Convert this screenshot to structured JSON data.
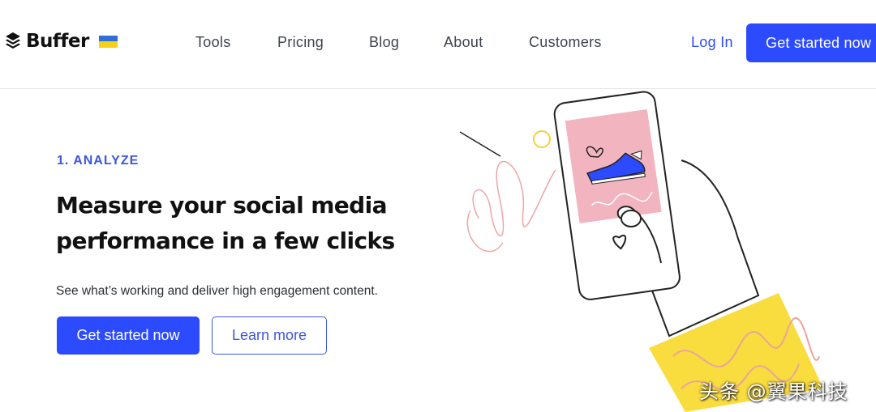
{
  "header": {
    "logo_text": "Buffer",
    "logo_icon": "buffer-stack-icon",
    "flag_icon": "ukraine-flag-icon",
    "nav": [
      {
        "label": "Tools"
      },
      {
        "label": "Pricing"
      },
      {
        "label": "Blog"
      },
      {
        "label": "About"
      },
      {
        "label": "Customers"
      }
    ],
    "login_label": "Log In",
    "cta_label": "Get started now"
  },
  "hero": {
    "eyebrow": "1. ANALYZE",
    "headline": "Measure your social media performance in a few clicks",
    "subtext": "See what’s working and deliver high engagement content.",
    "primary_button": "Get started now",
    "secondary_button": "Learn more"
  },
  "illustration": {
    "icon": "phone-in-hand-illustration",
    "colors": {
      "screen": "#f2b5c0",
      "shoe": "#2c4bff",
      "sleeve": "#f9dc3d",
      "accent": "#2c4bff"
    }
  },
  "watermark": "头条 @翼果科技"
}
